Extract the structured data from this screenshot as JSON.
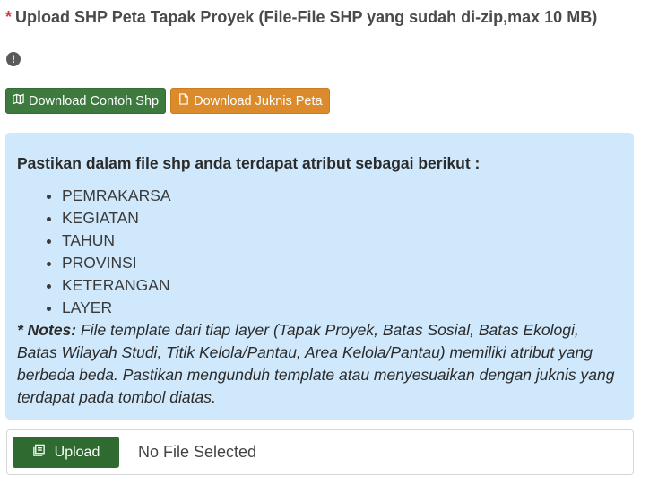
{
  "header": {
    "required_mark": "*",
    "title": "Upload SHP Peta Tapak Proyek (File-File SHP yang sudah di-zip,max 10 MB)",
    "info_icon_glyph": "!"
  },
  "buttons": {
    "download_sample": "Download Contoh Shp",
    "download_guide": "Download Juknis Peta"
  },
  "notice": {
    "heading": "Pastikan dalam file shp anda terdapat atribut sebagai berikut :",
    "attributes": [
      "PEMRAKARSA",
      "KEGIATAN",
      "TAHUN",
      "PROVINSI",
      "KETERANGAN",
      "LAYER"
    ],
    "notes_label": "* Notes:",
    "notes_text": " File template dari tiap layer (Tapak Proyek, Batas Sosial, Batas Ekologi, Batas Wilayah Studi, Titik Kelola/Pantau, Area Kelola/Pantau) memiliki atribut yang berbeda beda. Pastikan mengunduh template atau menyesuaikan dengan juknis yang terdapat pada tombol diatas."
  },
  "upload": {
    "button_label": "Upload",
    "status": "No File Selected"
  },
  "colors": {
    "required": "#d9333f",
    "green_button": "#3d7a3e",
    "orange_button": "#dc8b2c",
    "notice_bg": "#cfe8fb",
    "upload_button": "#2f6a30"
  }
}
